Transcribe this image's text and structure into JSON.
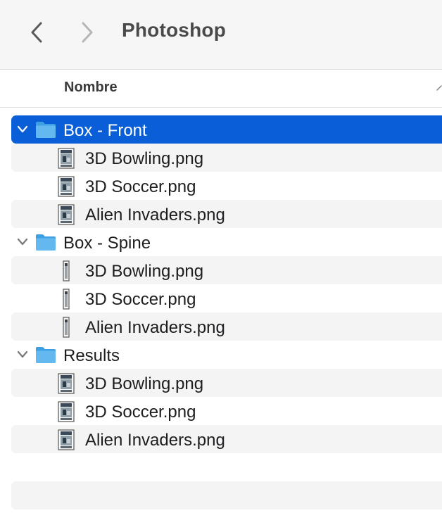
{
  "toolbar": {
    "title": "Photoshop",
    "back_icon": "chevron-left-icon",
    "forward_icon": "chevron-right-icon"
  },
  "columns": {
    "name": "Nombre"
  },
  "colors": {
    "selection": "#0a5fd8",
    "folder": "#5ab0ea",
    "alt_row": "#f4f4f5"
  },
  "tree": [
    {
      "name": "Box - Front",
      "expanded": true,
      "selected": true,
      "files": [
        {
          "name": "3D Bowling.png",
          "icon": "box-art-thumbnail-icon"
        },
        {
          "name": "3D Soccer.png",
          "icon": "box-art-thumbnail-icon"
        },
        {
          "name": "Alien Invaders.png",
          "icon": "box-art-thumbnail-icon"
        }
      ]
    },
    {
      "name": "Box - Spine",
      "expanded": true,
      "selected": false,
      "files": [
        {
          "name": "3D Bowling.png",
          "icon": "spine-thumbnail-icon"
        },
        {
          "name": "3D Soccer.png",
          "icon": "spine-thumbnail-icon"
        },
        {
          "name": "Alien Invaders.png",
          "icon": "spine-thumbnail-icon"
        }
      ]
    },
    {
      "name": "Results",
      "expanded": true,
      "selected": false,
      "files": [
        {
          "name": "3D Bowling.png",
          "icon": "box-art-thumbnail-icon"
        },
        {
          "name": "3D Soccer.png",
          "icon": "box-art-thumbnail-icon"
        },
        {
          "name": "Alien Invaders.png",
          "icon": "box-art-thumbnail-icon"
        }
      ]
    }
  ]
}
